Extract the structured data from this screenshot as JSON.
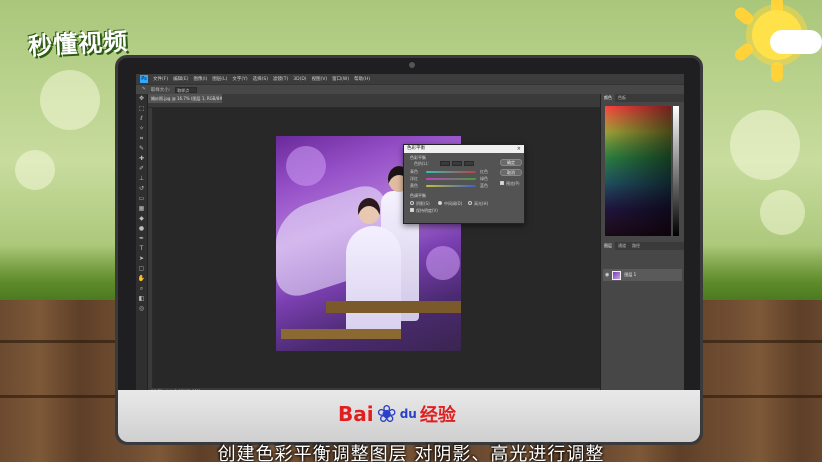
{
  "brand_logo": "秒懂视频",
  "watermark": {
    "brand": "Bai",
    "brand_du": "du",
    "brand_suffix": "经验"
  },
  "subtitle": "创建色彩平衡调整图层 对阴影、高光进行调整",
  "photoshop": {
    "menu": [
      "文件(F)",
      "编辑(E)",
      "图像(I)",
      "图层(L)",
      "文字(Y)",
      "选择(S)",
      "滤镜(T)",
      "3D(D)",
      "视图(V)",
      "窗口(W)",
      "帮助(H)"
    ],
    "options_bar": {
      "label": "取样大小:",
      "value": "取样点"
    },
    "document_tab": "婚纱照.jpg @ 16.7% (图层 1, RGB/8#)",
    "status": "16.7%    文档:3.00M/3.00M",
    "dialog": {
      "title": "色彩平衡",
      "section_balance": "色彩平衡",
      "levels_label": "色阶(L):",
      "sliders": [
        {
          "left": "青色",
          "right": "红色",
          "color": "#c04040"
        },
        {
          "left": "洋红",
          "right": "绿色",
          "color": "#40a040"
        },
        {
          "left": "黄色",
          "right": "蓝色",
          "color": "#4060c0"
        }
      ],
      "section_tone": "色调平衡",
      "tones": [
        "阴影(S)",
        "中间调(D)",
        "高光(H)"
      ],
      "preserve_luminosity": "保持明度(V)",
      "ok": "确定",
      "cancel": "取消",
      "preview": "预览(P)"
    },
    "color_panel_tabs": [
      "颜色",
      "色板"
    ],
    "layers_panel_tabs": [
      "图层",
      "通道",
      "路径"
    ],
    "layer_name": "图层 1"
  }
}
